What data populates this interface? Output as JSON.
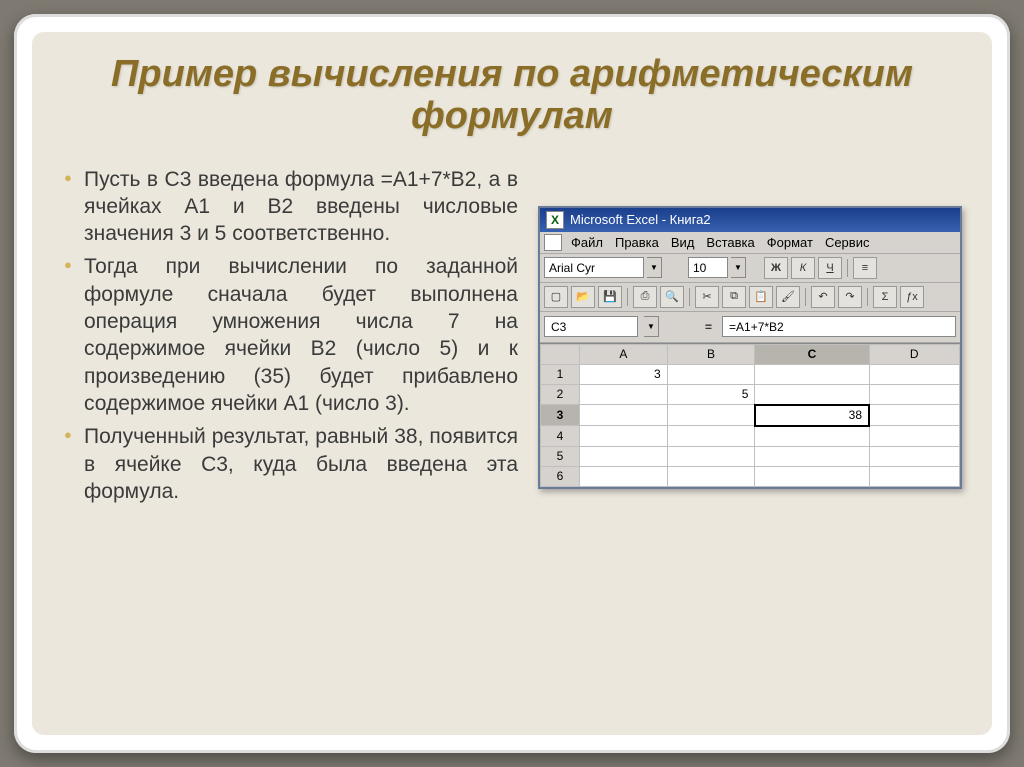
{
  "slide": {
    "title": "Пример вычисления по арифметическим формулам",
    "bullets": [
      "Пусть в C3 введена формула =A1+7*B2, а в ячейках A1 и B2 введены числовые значения 3 и 5 соответственно.",
      "Тогда при вычислении по заданной формуле сначала будет выполнена операция умножения числа 7 на содержимое ячейки B2 (число 5) и к произведению (35) будет прибавлено содержимое ячейки A1 (число 3).",
      "Полученный результат, равный 38, появится в ячейке C3, куда была введена эта формула."
    ]
  },
  "excel": {
    "titlebar": "Microsoft Excel - Книга2",
    "menu": [
      "Файл",
      "Правка",
      "Вид",
      "Вставка",
      "Формат",
      "Сервис"
    ],
    "font_name": "Arial Cyr",
    "font_size": "10",
    "style_buttons": {
      "bold": "Ж",
      "italic": "К",
      "underline": "Ч"
    },
    "cell_ref": "C3",
    "formula": "=A1+7*B2",
    "columns": [
      "A",
      "B",
      "C",
      "D"
    ],
    "rows": [
      "1",
      "2",
      "3",
      "4",
      "5",
      "6"
    ],
    "cells": {
      "A1": "3",
      "B2": "5",
      "C3": "38"
    },
    "selected_col": "C",
    "selected_row": "3"
  },
  "chart_data": {
    "type": "table",
    "title": "Excel cell values",
    "columns": [
      "A",
      "B",
      "C",
      "D"
    ],
    "rows": [
      {
        "row": 1,
        "A": 3,
        "B": "",
        "C": "",
        "D": ""
      },
      {
        "row": 2,
        "A": "",
        "B": 5,
        "C": "",
        "D": ""
      },
      {
        "row": 3,
        "A": "",
        "B": "",
        "C": 38,
        "D": ""
      },
      {
        "row": 4,
        "A": "",
        "B": "",
        "C": "",
        "D": ""
      },
      {
        "row": 5,
        "A": "",
        "B": "",
        "C": "",
        "D": ""
      },
      {
        "row": 6,
        "A": "",
        "B": "",
        "C": "",
        "D": ""
      }
    ],
    "formula_cell": "C3",
    "formula": "=A1+7*B2"
  }
}
